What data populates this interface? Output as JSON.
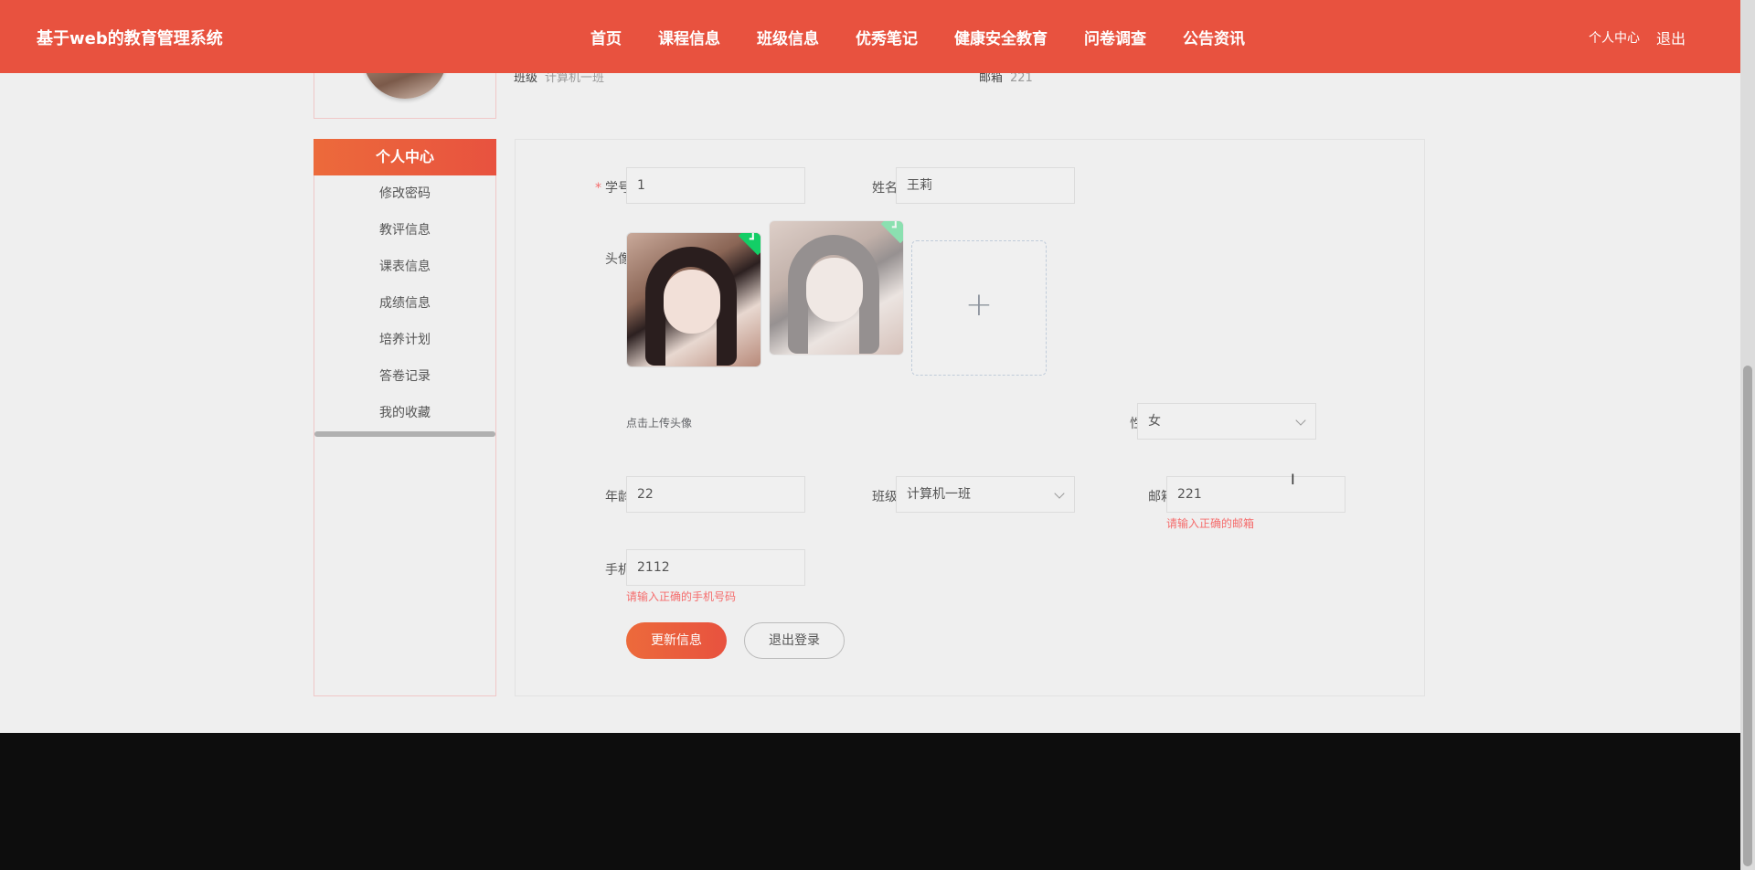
{
  "header": {
    "brand": "基于web的教育管理系统",
    "nav": [
      "首页",
      "课程信息",
      "班级信息",
      "优秀笔记",
      "健康安全教育",
      "问卷调查",
      "公告资讯"
    ],
    "user_center": "个人中心",
    "logout": "退出"
  },
  "profile_strip": {
    "class_label": "班级",
    "class_value": "计算机一班",
    "email_label": "邮箱",
    "email_value": "221"
  },
  "sidebar": {
    "title": "个人中心",
    "items": [
      "修改密码",
      "教评信息",
      "课表信息",
      "成绩信息",
      "培养计划",
      "答卷记录",
      "我的收藏"
    ]
  },
  "form": {
    "student_id_label": "学号",
    "student_id_value": "1",
    "name_label": "姓名",
    "name_value": "王莉",
    "avatar_label": "头像",
    "upload_hint": "点击上传头像",
    "gender_label": "性别",
    "gender_value": "女",
    "age_label": "年龄",
    "age_value": "22",
    "class_label": "班级",
    "class_value": "计算机一班",
    "email_label": "邮箱",
    "email_value": "221",
    "email_error": "请输入正确的邮箱",
    "phone_label": "手机",
    "phone_value": "2112",
    "phone_error": "请输入正确的手机号码",
    "update_button": "更新信息",
    "logout_button": "退出登录"
  }
}
